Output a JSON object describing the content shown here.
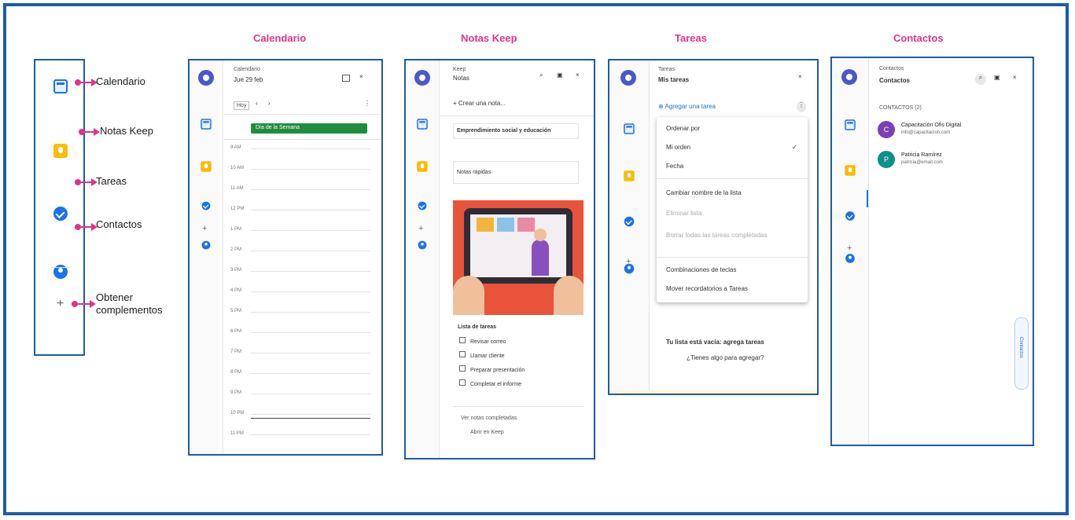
{
  "titles": {
    "calendario": "Calendario",
    "notas_keep": "Notas Keep",
    "tareas": "Tareas",
    "contactos": "Contactos"
  },
  "legend": {
    "calendario": "Calendario",
    "notas_keep": "Notas Keep",
    "tareas": "Tareas",
    "contactos": "Contactos",
    "obtener_complementos": "Obtener complementos"
  },
  "calendar_panel": {
    "app_name": "Calendario",
    "date_selector": "Jue 29 feb",
    "view_today": "Hoy",
    "nav_prev": "‹",
    "nav_next": "›",
    "event_label": "Día de la Semana",
    "time_slots": [
      "9 AM",
      "10 AM",
      "11 AM",
      "12 PM",
      "1 PM",
      "2 PM",
      "3 PM",
      "4 PM",
      "5 PM",
      "6 PM",
      "7 PM",
      "8 PM",
      "9 PM",
      "10 PM",
      "11 PM"
    ]
  },
  "keep_panel": {
    "app_name": "Keep",
    "subtitle": "Notas",
    "search_placeholder": "Crear una nota...",
    "note1": "Emprendimiento social y educación",
    "note2": "Notas rápidas",
    "list_title": "Lista de tareas",
    "list_items": [
      "Revisar correo",
      "Llamar cliente",
      "Preparar presentación",
      "Completar el informe"
    ],
    "footer1": "Ver notas completadas",
    "footer2": "Abrir en Keep"
  },
  "tasks_panel": {
    "app_name": "Tareas",
    "list_selector": "Mis tareas",
    "add_task": "Agregar una tarea",
    "menu_heading": "Ordenar por",
    "menu_items": [
      {
        "label": "Mi orden",
        "checked": true,
        "dim": false
      },
      {
        "label": "Fecha",
        "checked": false,
        "dim": false
      },
      {
        "label": "Cambiar nombre de la lista",
        "checked": false,
        "dim": false
      },
      {
        "label": "Eliminar lista",
        "checked": false,
        "dim": true
      },
      {
        "label": "Borrar todas las tareas completadas",
        "checked": false,
        "dim": true
      },
      {
        "label": "Combinaciones de teclas",
        "checked": false,
        "dim": false
      },
      {
        "label": "Mover recordatorios a Tareas",
        "checked": false,
        "dim": false
      }
    ],
    "empty_title": "Tu lista está vacía: agrega tareas",
    "empty_sub": "¿Tienes algo para agregar?"
  },
  "contacts_panel": {
    "app_name": "Contactos",
    "subtitle": "Contactos",
    "section_label": "CONTACTOS (2)",
    "contacts": [
      {
        "name": "Capacitación Ofis Digital",
        "email": "info@capacitacion.com",
        "initial": "C",
        "color": "#7b3fb8"
      },
      {
        "name": "Patricia Ramírez",
        "email": "patricia@email.com",
        "initial": "P",
        "color": "#0f8f8a"
      }
    ],
    "side_tab": "Contactos"
  }
}
